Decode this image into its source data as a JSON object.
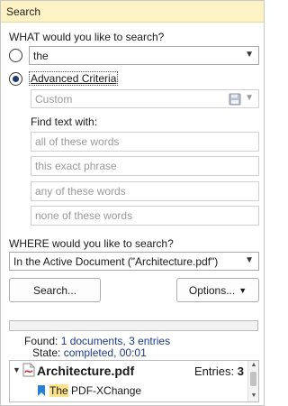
{
  "title": "Search",
  "what_label": "WHAT would you like to search?",
  "query": {
    "value": "the"
  },
  "advanced": {
    "label": "Advanced Criteria",
    "preset": "Custom"
  },
  "find_text": {
    "label": "Find text with:",
    "all_words": "all of these words",
    "exact_phrase": "this exact phrase",
    "any_words": "any of these words",
    "none_words": "none of these words"
  },
  "where": {
    "label": "WHERE would you like to search?",
    "value": "In the Active Document (\"Architecture.pdf\")"
  },
  "buttons": {
    "search": "Search...",
    "options": "Options..."
  },
  "status": {
    "found_label": "Found:",
    "found_value": "1 documents, 3 entries",
    "state_label": "State:",
    "state_value": "completed, 00:01"
  },
  "results": {
    "file_name": "Architecture.pdf",
    "entries_label": "Entries:",
    "entries_count": "3",
    "match_highlight": "The",
    "match_rest": " PDF-XChange"
  },
  "colors": {
    "title_bg": "#fdf2c4",
    "accent_blue": "#1e3a8a",
    "highlight": "#fce28a"
  }
}
